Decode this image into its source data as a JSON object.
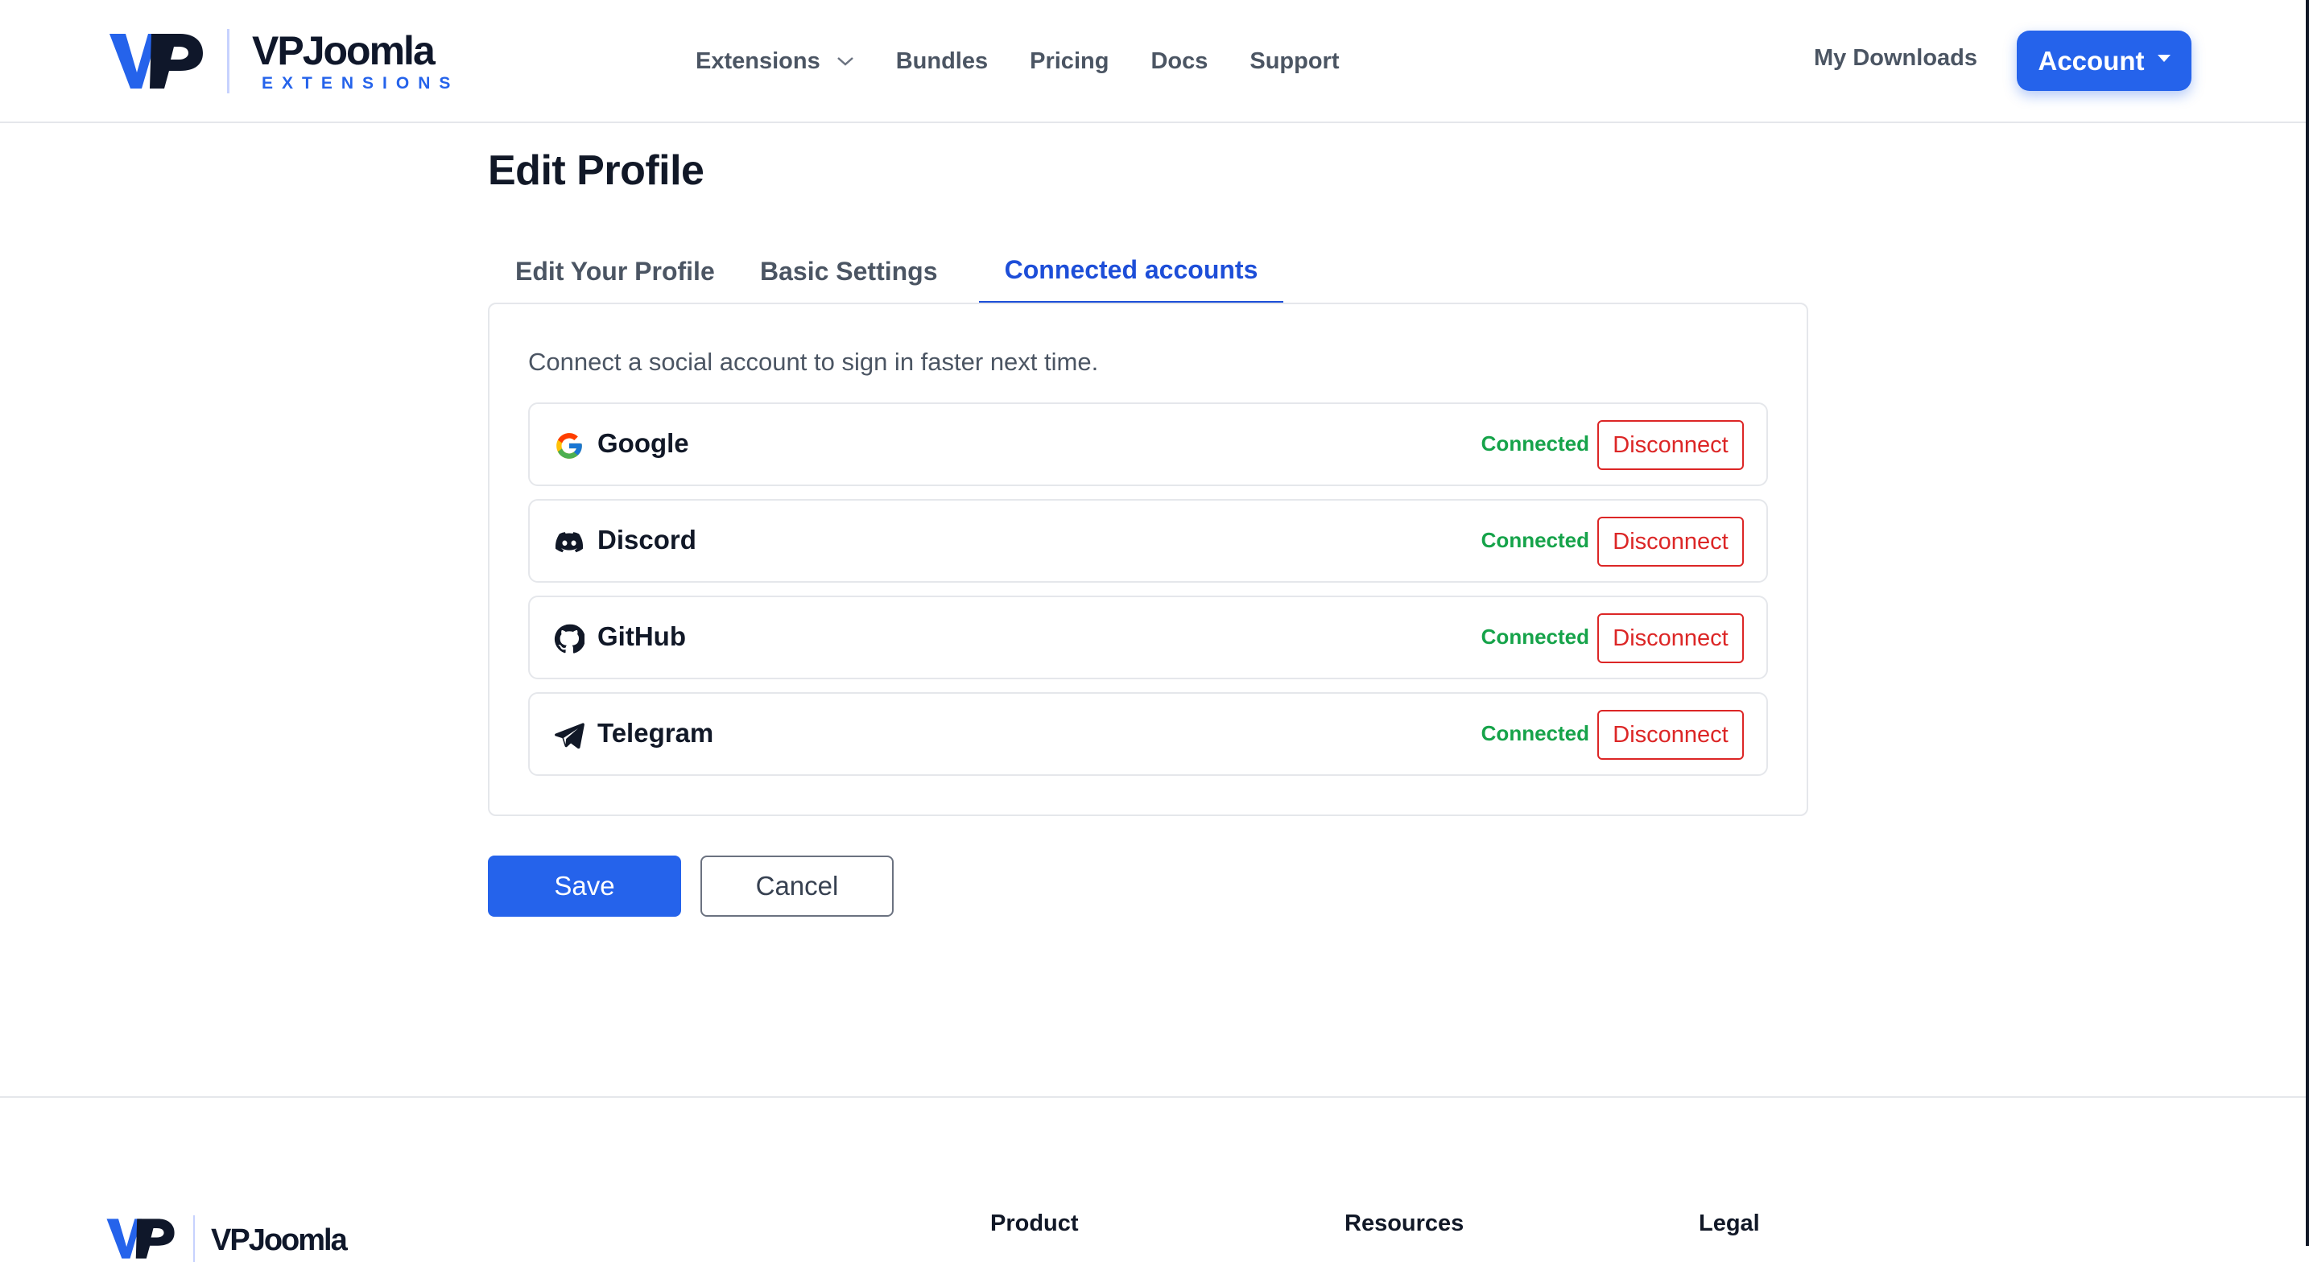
{
  "brand": {
    "name": "VPJoomla",
    "tagline": "EXTENSIONS",
    "color_primary": "#2563eb",
    "color_dark": "#0f172a"
  },
  "nav": {
    "items": [
      {
        "label": "Extensions",
        "has_dropdown": true
      },
      {
        "label": "Bundles"
      },
      {
        "label": "Pricing"
      },
      {
        "label": "Docs"
      },
      {
        "label": "Support"
      }
    ],
    "my_downloads": "My Downloads",
    "account_label": "Account"
  },
  "page": {
    "title": "Edit Profile",
    "tabs": [
      {
        "label": "Edit Your Profile",
        "active": false
      },
      {
        "label": "Basic Settings",
        "active": false
      },
      {
        "label": "Connected accounts",
        "active": true
      }
    ],
    "description": "Connect a social account to sign in faster next time.",
    "accounts": [
      {
        "name": "Google",
        "icon": "google-icon",
        "status": "Connected",
        "action": "Disconnect"
      },
      {
        "name": "Discord",
        "icon": "discord-icon",
        "status": "Connected",
        "action": "Disconnect"
      },
      {
        "name": "GitHub",
        "icon": "github-icon",
        "status": "Connected",
        "action": "Disconnect"
      },
      {
        "name": "Telegram",
        "icon": "telegram-icon",
        "status": "Connected",
        "action": "Disconnect"
      }
    ],
    "save_label": "Save",
    "cancel_label": "Cancel",
    "status_color": "#16a34a",
    "danger_color": "#dc2626"
  },
  "footer": {
    "brand": "VPJoomla",
    "headings": [
      "Product",
      "Resources",
      "Legal"
    ]
  }
}
